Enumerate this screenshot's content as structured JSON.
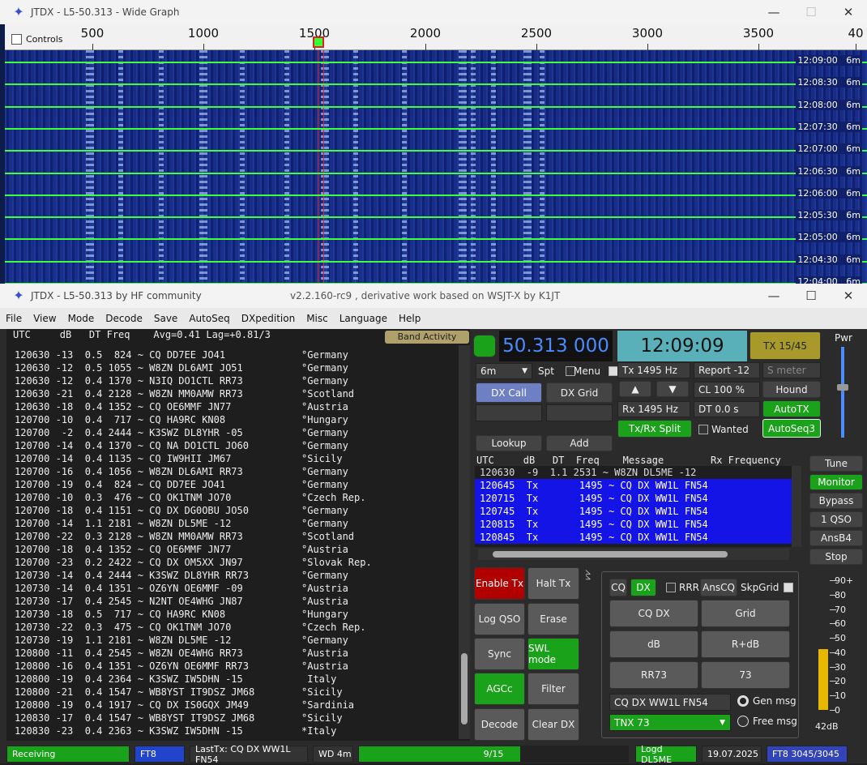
{
  "wide_graph": {
    "title": "JTDX - L5-50.313 - Wide Graph",
    "controls_label": "Controls",
    "scale_labels": [
      "500",
      "1000",
      "1500",
      "2000",
      "2500",
      "3000",
      "3500",
      "40"
    ],
    "times": [
      "12:09:00",
      "12:08:30",
      "12:08:00",
      "12:07:30",
      "12:07:00",
      "12:06:30",
      "12:06:00",
      "12:05:30",
      "12:05:00",
      "12:04:30",
      "12:04:00"
    ],
    "band": "6m"
  },
  "main": {
    "title": "JTDX - L5-50.313  by HF community",
    "subtitle": "v2.2.160-rc9 , derivative work based on WSJT-X by K1JT",
    "menu": [
      "File",
      "View",
      "Mode",
      "Decode",
      "Save",
      "AutoSeq",
      "DXpedition",
      "Misc",
      "Language",
      "Help"
    ],
    "band_header": "UTC     dB   DT Freq    Avg=0.41 Lag=+0.81/3",
    "band_activity_label": "Band Activity",
    "decodes": [
      "120630 -13  0.5  824 ~ CQ DD7EE JO41             °Germany",
      "120630 -12  0.5 1055 ~ W8ZN DL6AMI JO51          °Germany",
      "120630 -12  0.4 1370 ~ N3IQ DO1CTL RR73          °Germany",
      "120630 -21  0.4 2128 ~ W8ZN MM0AMW RR73          °Scotland",
      "120630 -18  0.4 1352 ~ CQ OE6MMF JN77            °Austria",
      "120700 -10  0.4  717 ~ CQ HA9RC KN08             °Hungary",
      "120700  -2  0.4 2444 ~ K3SWZ DL8YHR -05          °Germany",
      "120700 -14  0.4 1370 ~ CQ NA DO1CTL JO60         °Germany",
      "120700 -14  0.4 1135 ~ CQ IW9HII JM67            °Sicily",
      "120700 -16  0.4 1056 ~ W8ZN DL6AMI RR73          °Germany",
      "120700 -19  0.4  824 ~ CQ DD7EE JO41             °Germany",
      "120700 -10  0.3  476 ~ CQ OK1TNM JO70            °Czech Rep.",
      "120700 -18  0.4 1151 ~ CQ DX DG0OBU JO50         °Germany",
      "120700 -14  1.1 2181 ~ W8ZN DL5ME -12            °Germany",
      "120700 -22  0.3 2128 ~ W8ZN MM0AMW RR73          °Scotland",
      "120700 -18  0.4 1352 ~ CQ OE6MMF JN77            °Austria",
      "120700 -23  0.2 2422 ~ CQ DX OM5XX JN97          °Slovak Rep.",
      "120730 -14  0.4 2444 ~ K3SWZ DL8YHR RR73         °Germany",
      "120730 -14  0.4 1351 ~ OZ6YN OE6MMF -09          °Austria",
      "120730 -17  0.4 2545 ~ N2NT OE4WHG JN87          °Austria",
      "120730 -18  0.5  717 ~ CQ HA9RC KN08             °Hungary",
      "120730 -22  0.3  475 ~ CQ OK1TNM JO70            °Czech Rep.",
      "120730 -19  1.1 2181 ~ W8ZN DL5ME -12            °Germany",
      "120800 -11  0.4 2545 ~ W8ZN OE4WHG RR73          °Austria",
      "120800 -16  0.4 1351 ~ OZ6YN OE6MMF RR73         °Austria",
      "120800 -19  0.4 2364 ~ K3SWZ IW5DHN -15           Italy",
      "120800 -21  0.4 1547 ~ WB8YST IT9DSZ JM68        °Sicily",
      "120800 -19  0.4 1917 ~ CQ DX IS0GQX JM49         °Sardinia",
      "120830 -17  0.4 1547 ~ WB8YST IT9DSZ JM68        °Sicily",
      "120830 -23  0.4 2363 ~ K3SWZ IW5DHN -15          *Italy"
    ],
    "freq_display": "50.313 000",
    "clock": "12:09:09",
    "tx_slot": "TX 15/45",
    "pwr_label": "Pwr",
    "band_select": "6m",
    "spt_label": "Spt",
    "menu_label": "Menu",
    "tx_hz": "Tx  1495  Hz",
    "rx_hz": "Rx  1495  Hz",
    "report": "Report -12",
    "s_meter": "S meter",
    "cl": "CL  100 %",
    "hound": "Hound",
    "dt": "DT 0.0 s",
    "autotx": "AutoTX",
    "txrx_split": "Tx/Rx Split",
    "wanted": "Wanted",
    "autoseq3": "AutoSeq3",
    "dx_call": "DX Call",
    "dx_grid": "DX Grid",
    "lookup": "Lookup",
    "add": "Add",
    "rx_header": "UTC     dB   DT  Freq    Message        Rx Frequency",
    "rx_rows": [
      {
        "text": "120630  -9  1.1 2531 ~ W8ZN DL5ME -12",
        "tx": false
      },
      {
        "text": "120645  Tx       1495 ~ CQ DX WW1L FN54",
        "tx": true
      },
      {
        "text": "120715  Tx       1495 ~ CQ DX WW1L FN54",
        "tx": true
      },
      {
        "text": "120745  Tx       1495 ~ CQ DX WW1L FN54",
        "tx": true
      },
      {
        "text": "120815  Tx       1495 ~ CQ DX WW1L FN54",
        "tx": true
      },
      {
        "text": "120845  Tx       1495 ~ CQ DX WW1L FN54",
        "tx": true
      }
    ],
    "side_buttons": [
      "Tune",
      "Monitor",
      "Bypass",
      "1 QSO",
      "AnsB4",
      "Stop"
    ],
    "enable_tx": "Enable Tx",
    "halt_tx": "Halt Tx",
    "log_qso": "Log QSO",
    "erase": "Erase",
    "sync": "Sync",
    "swl_mode": "SWL mode",
    "agcc": "AGCc",
    "filter": "Filter",
    "decode": "Decode",
    "clear_dx": "Clear DX",
    "cq": "CQ",
    "dx": "DX",
    "rrr": "RRR",
    "anscq": "AnsCQ",
    "skpgrid": "SkpGrid",
    "msg_buttons": [
      "CQ DX",
      "Grid",
      "dB",
      "R+dB",
      "RR73",
      "73"
    ],
    "gen_msg_text": "CQ DX WW1L FN54",
    "gen_msg": "Gen msg",
    "free_msg_text": "TNX 73",
    "free_msg": "Free msg",
    "meter_labels": [
      "90+",
      "80",
      "70",
      "60",
      "50",
      "40",
      "30",
      "20",
      "10",
      "0"
    ],
    "meter_level_db": 42,
    "meter_value": "42dB"
  },
  "status": {
    "state": "Receiving",
    "mode": "FT8",
    "last_tx": "LastTx: CQ DX WW1L FN54",
    "wd": "WD 4m",
    "progress": "9/15",
    "progress_fraction": 0.6,
    "logd": "Logd DL5ME",
    "date": "19.07.2025",
    "ft8_count": "FT8  3045/3045"
  }
}
